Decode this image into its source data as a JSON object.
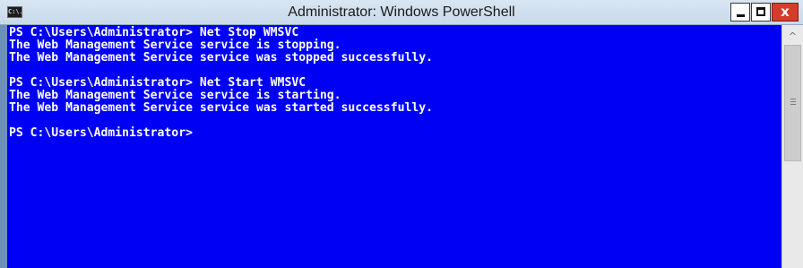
{
  "window": {
    "title": "Administrator: Windows PowerShell",
    "icon": "powershell-console-icon",
    "icon_text": "C:\\."
  },
  "controls": {
    "minimize_icon": "minimize-icon",
    "maximize_icon": "maximize-icon",
    "close_icon": "close-icon",
    "close_glyph": "x"
  },
  "console": {
    "background": "#0000f5",
    "foreground": "#ffffff",
    "lines": [
      "PS C:\\Users\\Administrator> Net Stop WMSVC",
      "The Web Management Service service is stopping.",
      "The Web Management Service service was stopped successfully.",
      "",
      "PS C:\\Users\\Administrator> Net Start WMSVC",
      "The Web Management Service service is starting.",
      "The Web Management Service service was started successfully.",
      "",
      "PS C:\\Users\\Administrator>"
    ]
  },
  "scrollbar": {
    "up_arrow": "^",
    "up_icon": "scroll-up-arrow-icon",
    "thumb_icon": "scroll-thumb-grip-icon"
  },
  "colors": {
    "titlebar": "#d3e2f0",
    "frame": "#6c8fbd",
    "close_button": "#d53c2c"
  }
}
